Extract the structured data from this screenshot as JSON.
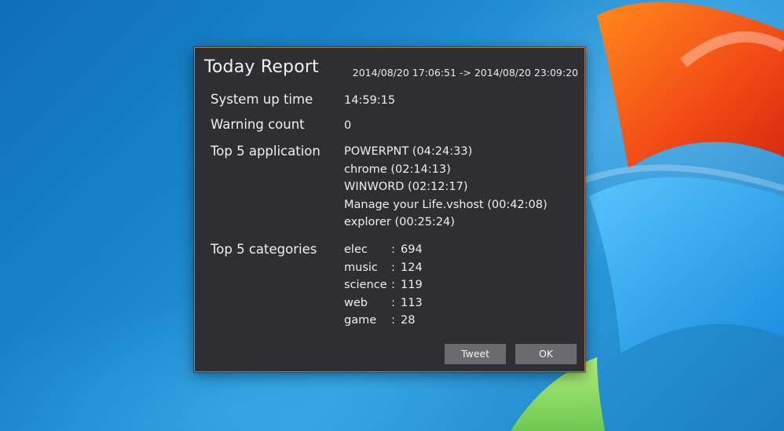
{
  "dialog": {
    "title": "Today Report",
    "range": "2014/08/20 17:06:51 -> 2014/08/20 23:09:20",
    "uptime": {
      "label": "System up time",
      "value": "14:59:15"
    },
    "warning": {
      "label": "Warning count",
      "value": "0"
    },
    "apps": {
      "label": "Top 5 application",
      "items": [
        "POWERPNT (04:24:33)",
        "chrome (02:14:13)",
        "WINWORD (02:12:17)",
        "Manage your Life.vshost (00:42:08)",
        "explorer (00:25:24)"
      ]
    },
    "categories": {
      "label": "Top 5 categories",
      "separator": ":",
      "items": [
        {
          "name": "elec",
          "value": "694"
        },
        {
          "name": "music",
          "value": "124"
        },
        {
          "name": "science",
          "value": "119"
        },
        {
          "name": "web",
          "value": "113"
        },
        {
          "name": "game",
          "value": "28"
        }
      ]
    },
    "buttons": {
      "tweet": "Tweet",
      "ok": "OK"
    }
  },
  "colors": {
    "dialog_bg": "#2f2e33",
    "dialog_border": "#c07a3a",
    "button_bg": "#6b6a6f"
  }
}
